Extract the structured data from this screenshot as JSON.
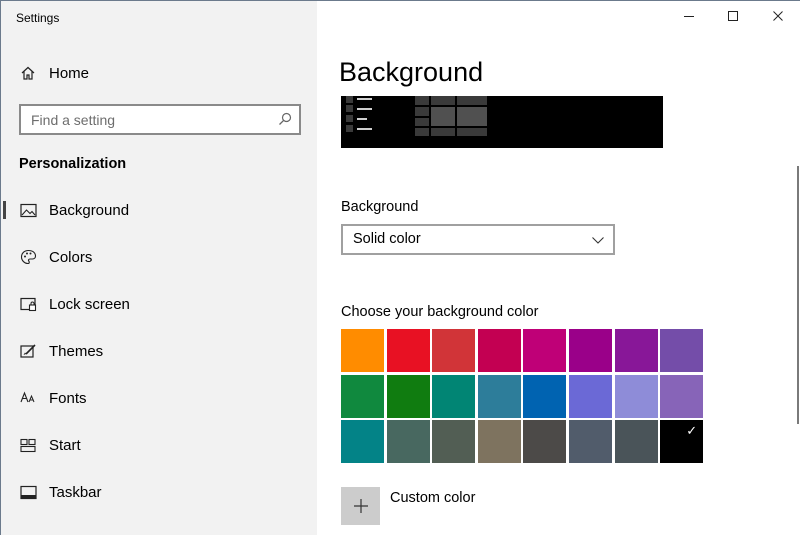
{
  "window": {
    "app_title": "Settings",
    "controls": [
      "minimize-icon",
      "maximize-icon",
      "close-icon"
    ]
  },
  "sidebar": {
    "home_label": "Home",
    "search_placeholder": "Find a setting",
    "section_title": "Personalization",
    "items": [
      {
        "label": "Background",
        "icon": "picture-icon",
        "active": true
      },
      {
        "label": "Colors",
        "icon": "palette-icon",
        "active": false
      },
      {
        "label": "Lock screen",
        "icon": "lock-screen-icon",
        "active": false
      },
      {
        "label": "Themes",
        "icon": "themes-icon",
        "active": false
      },
      {
        "label": "Fonts",
        "icon": "fonts-icon",
        "active": false
      },
      {
        "label": "Start",
        "icon": "start-icon",
        "active": false
      },
      {
        "label": "Taskbar",
        "icon": "taskbar-icon",
        "active": false
      }
    ]
  },
  "main": {
    "title": "Background",
    "background_label": "Background",
    "background_value": "Solid color",
    "choose_color_label": "Choose your background color",
    "colors": [
      [
        "#ff8c00",
        "#e81123",
        "#d13438",
        "#c30052",
        "#bf0077",
        "#9a0089",
        "#881798",
        "#744da9"
      ],
      [
        "#10893e",
        "#107c10",
        "#018574",
        "#2d7d9a",
        "#0063b1",
        "#6b69d6",
        "#8e8cd8",
        "#8764b8"
      ],
      [
        "#038387",
        "#486860",
        "#525e54",
        "#7e735f",
        "#4c4a48",
        "#515c6b",
        "#4a5459",
        "#000000"
      ]
    ],
    "selected_color": "#000000",
    "custom_color_label": "Custom color"
  }
}
